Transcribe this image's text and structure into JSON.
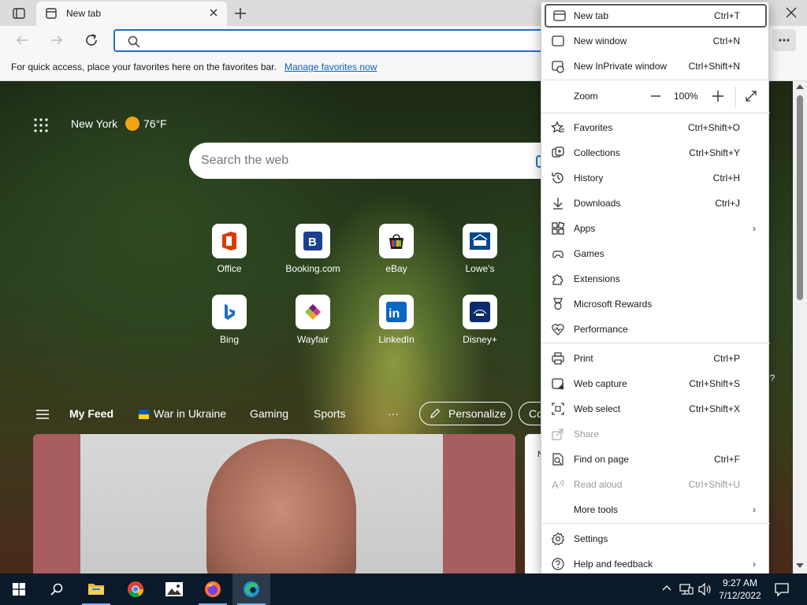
{
  "browser": {
    "tab_title": "New tab",
    "favorites_bar_message": "For quick access, place your favorites here on the favorites bar.",
    "favorites_bar_link": "Manage favorites now"
  },
  "newtab": {
    "location": "New York",
    "temperature": "76°F",
    "search_placeholder": "Search the web",
    "tiles": [
      {
        "label": "Office",
        "icon": "office-icon"
      },
      {
        "label": "Booking.com",
        "icon": "booking-icon"
      },
      {
        "label": "eBay",
        "icon": "ebay-icon"
      },
      {
        "label": "Lowe's",
        "icon": "lowes-icon"
      },
      {
        "label": "Bing",
        "icon": "bing-icon"
      },
      {
        "label": "Wayfair",
        "icon": "wayfair-icon"
      },
      {
        "label": "LinkedIn",
        "icon": "linkedin-icon"
      },
      {
        "label": "Disney+",
        "icon": "disney-icon"
      }
    ],
    "feed": {
      "items": [
        "My Feed",
        "War in Ukraine",
        "Gaming",
        "Sports"
      ],
      "more": "···",
      "personalize": "Personalize",
      "next_pill": "Co",
      "card2_text": "N",
      "behind_text": "d?"
    }
  },
  "menu": {
    "items": [
      {
        "label": "New tab",
        "shortcut": "Ctrl+T",
        "icon": "new-tab-icon"
      },
      {
        "label": "New window",
        "shortcut": "Ctrl+N",
        "icon": "new-window-icon"
      },
      {
        "label": "New InPrivate window",
        "shortcut": "Ctrl+Shift+N",
        "icon": "inprivate-icon"
      },
      {
        "label": "Zoom",
        "zoom_value": "100%"
      },
      {
        "label": "Favorites",
        "shortcut": "Ctrl+Shift+O",
        "icon": "favorites-icon"
      },
      {
        "label": "Collections",
        "shortcut": "Ctrl+Shift+Y",
        "icon": "collections-icon"
      },
      {
        "label": "History",
        "shortcut": "Ctrl+H",
        "icon": "history-icon"
      },
      {
        "label": "Downloads",
        "shortcut": "Ctrl+J",
        "icon": "downloads-icon"
      },
      {
        "label": "Apps",
        "arrow": "›",
        "icon": "apps-icon"
      },
      {
        "label": "Games",
        "icon": "games-icon"
      },
      {
        "label": "Extensions",
        "icon": "extensions-icon"
      },
      {
        "label": "Microsoft Rewards",
        "icon": "rewards-icon"
      },
      {
        "label": "Performance",
        "icon": "performance-icon"
      },
      {
        "label": "Print",
        "shortcut": "Ctrl+P",
        "icon": "print-icon"
      },
      {
        "label": "Web capture",
        "shortcut": "Ctrl+Shift+S",
        "icon": "web-capture-icon"
      },
      {
        "label": "Web select",
        "shortcut": "Ctrl+Shift+X",
        "icon": "web-select-icon"
      },
      {
        "label": "Share",
        "icon": "share-icon"
      },
      {
        "label": "Find on page",
        "shortcut": "Ctrl+F",
        "icon": "find-icon"
      },
      {
        "label": "Read aloud",
        "shortcut": "Ctrl+Shift+U",
        "icon": "read-aloud-icon"
      },
      {
        "label": "More tools",
        "arrow": "›",
        "icon": "more-tools-icon"
      },
      {
        "label": "Settings",
        "icon": "settings-icon"
      },
      {
        "label": "Help and feedback",
        "arrow": "›",
        "icon": "help-icon"
      }
    ]
  },
  "taskbar": {
    "time": "9:27 AM",
    "date": "7/12/2022"
  },
  "colors": {
    "accent": "#1f6fd1",
    "taskbar": "#0b1a2a",
    "link": "#0b62c4"
  }
}
